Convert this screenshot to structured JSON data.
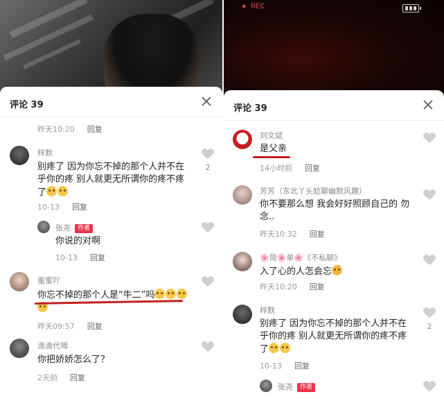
{
  "left": {
    "sheet_title": "评论 39",
    "top_meta": {
      "time": "昨天10:20",
      "reply": "回复"
    },
    "comments": [
      {
        "user": "梓默",
        "text": "别疼了 因为你忘不掉的那个人并不在乎你的疼 别人就更无所谓你的疼不疼了",
        "time": "10-13",
        "reply": "回复",
        "likes": "2"
      },
      {
        "user": "张尧",
        "badge": "作者",
        "text": "你说的对啊",
        "time": "10-13",
        "reply": "回复"
      },
      {
        "user": "蜜蜜吖",
        "text": "你忘不掉的那个人是“牛二”吗",
        "time": "昨天09:57",
        "reply": "回复"
      },
      {
        "user": "滴滴代喝",
        "text": "你把娇娇怎么了？",
        "time": "2天前",
        "reply": "回复"
      }
    ]
  },
  "right": {
    "rec_label": "REC",
    "sheet_title": "评论 39",
    "comments": [
      {
        "user": "刘文斌",
        "text": "是父亲",
        "time": "14小时前",
        "reply": "回复"
      },
      {
        "user": "芳芳（东北丫头尬聊幽默风趣）",
        "text": "你不要那么想 我会好好照顾自己的 勿念..",
        "time": "昨天10:32",
        "reply": "回复"
      },
      {
        "user": "🌸简🌸单🌸《不私聊》",
        "text": "入了心的人怎会忘",
        "time": "昨天10:20",
        "reply": "回复"
      },
      {
        "user": "梓默",
        "text": "别疼了 因为你忘不掉的那个人并不在乎你的疼 别人就更无所谓你的疼不疼了",
        "time": "10-13",
        "reply": "回复",
        "likes": "2"
      },
      {
        "user": "张尧",
        "badge": "作者"
      }
    ]
  },
  "colors": {
    "underline": "#c41e1e",
    "badge": "#e8334a",
    "like": "#d0d0d0"
  }
}
